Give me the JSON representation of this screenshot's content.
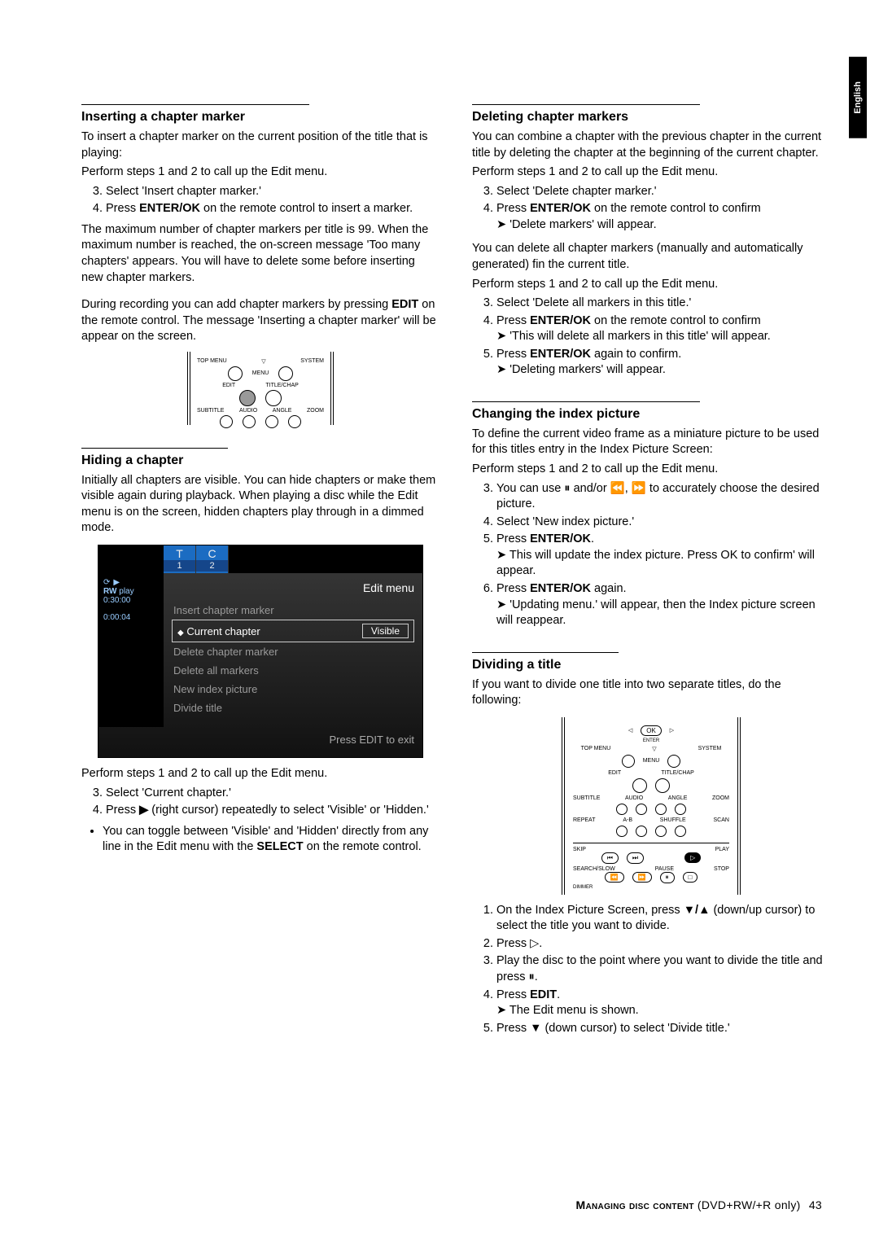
{
  "lang_tab": "English",
  "left": {
    "s1": {
      "h": "Inserting a chapter marker",
      "p1": "To insert a chapter marker on the current position of the title that is playing:",
      "p2": "Perform steps 1 and 2 to call up the Edit menu.",
      "li3": "Select 'Insert chapter marker.'",
      "li4a": "Press ",
      "li4b": "ENTER/OK",
      "li4c": " on the remote control to insert a marker.",
      "p3": "The maximum number of chapter markers per title is 99. When the maximum number is reached, the on-screen message 'Too many chapters' appears. You will have to delete some before inserting new chapter markers.",
      "p4a": "During recording you can add chapter markers by pressing ",
      "p4b": "EDIT",
      "p4c": " on the remote control. The message 'Inserting a chapter marker' will be appear on the screen.",
      "remote_labels": {
        "topmenu": "TOP MENU",
        "system": "SYSTEM",
        "menu": "MENU",
        "edit": "EDIT",
        "titlechap": "TITLE/CHAP",
        "subtitle": "SUBTITLE",
        "audio": "AUDIO",
        "angle": "ANGLE",
        "zoom": "ZOOM"
      }
    },
    "s2": {
      "h": "Hiding a chapter",
      "p1": "Initially all chapters are visible. You can hide chapters or make them visible again during playback. When playing a disc while the Edit menu is on the screen, hidden chapters play through in a dimmed mode.",
      "menu": {
        "t": "T",
        "c": "C",
        "n1": "1",
        "n2": "2",
        "rw": "RW",
        "play": "play",
        "time1": "0:30:00",
        "time2": "0:00:04",
        "title": "Edit menu",
        "insert": "Insert chapter marker",
        "current": "Current chapter",
        "visible": "Visible",
        "delete": "Delete chapter marker",
        "deleteall": "Delete all markers",
        "newindex": "New index picture",
        "divide": "Divide title",
        "foot": "Press EDIT to exit"
      },
      "p2": "Perform steps 1 and 2 to call up the Edit menu.",
      "li3": "Select 'Current chapter.'",
      "li4a": "Press ",
      "li4b": "▶",
      "li4c": " (right cursor) repeatedly to select 'Visible' or 'Hidden.'",
      "bul_a": "You can toggle between 'Visible' and 'Hidden' directly from any line in the Edit menu with the ",
      "bul_b": "SELECT",
      "bul_c": " on the remote control."
    }
  },
  "right": {
    "s1": {
      "h": "Deleting chapter markers",
      "p1": "You can combine a chapter with the previous chapter in the current title by deleting the chapter at the beginning of the current chapter.",
      "p2": "Perform steps 1 and 2 to call up the Edit menu.",
      "li3": "Select 'Delete chapter marker.'",
      "li4a": "Press ",
      "li4b": "ENTER/OK",
      "li4c": " on the remote control to confirm",
      "li4r": "'Delete markers' will appear.",
      "p3": "You can delete all chapter markers (manually and automatically generated) fin the current title.",
      "p4": "Perform steps 1 and 2 to call up the Edit menu.",
      "li3b": "Select 'Delete all markers in this title.'",
      "li4ba": "Press ",
      "li4bb": "ENTER/OK",
      "li4bc": " on the remote control to confirm",
      "li4br": "'This will delete all markers in this title' will appear.",
      "li5a": "Press ",
      "li5b": "ENTER/OK",
      "li5c": " again to confirm.",
      "li5r": "'Deleting markers' will appear."
    },
    "s2": {
      "h": "Changing the index picture",
      "p1": "To define the current video frame as a miniature picture to be used for this titles entry in the Index Picture Screen:",
      "p2": "Perform steps 1 and 2 to call up the Edit menu.",
      "li3": "You can use ⏸ and/or ⏪, ⏩ to accurately choose the desired picture.",
      "li4": "Select 'New index picture.'",
      "li5a": "Press ",
      "li5b": "ENTER/OK",
      "li5c": ".",
      "li5r": "This will update the index picture. Press OK to confirm' will appear.",
      "li6a": "Press ",
      "li6b": "ENTER/OK",
      "li6c": " again.",
      "li6r": "'Updating menu.' will appear, then the Index picture screen will reappear."
    },
    "s3": {
      "h": "Dividing a title",
      "p1": "If you want to divide one title into two separate titles, do the following:",
      "remote": {
        "ok": "OK",
        "enter": "ENTER",
        "topmenu": "TOP MENU",
        "system": "SYSTEM",
        "menu": "MENU",
        "edit": "EDIT",
        "titlechap": "TITLE/CHAP",
        "subtitle": "SUBTITLE",
        "audio": "AUDIO",
        "angle": "ANGLE",
        "zoom": "ZOOM",
        "repeat": "REPEAT",
        "ab": "A-B",
        "shuffle": "SHUFFLE",
        "scan": "SCAN",
        "skip": "SKIP",
        "play": "PLAY",
        "search": "SEARCH/SLOW",
        "pause": "PAUSE",
        "stop": "STOP",
        "dimmer": "DIMMER"
      },
      "li1a": "On the Index Picture Screen, press ",
      "li1b": "▼/▲",
      "li1c": " (down/up cursor) to select the title you want to divide.",
      "li2": "Press ▷.",
      "li3": "Play the disc to the point where you want to divide the title and press ⏸.",
      "li4a": "Press ",
      "li4b": "EDIT",
      "li4c": ".",
      "li4r": "The Edit menu is shown.",
      "li5a": "Press ",
      "li5b": "▼",
      "li5c": " (down cursor) to select 'Divide title.'"
    }
  },
  "footer": {
    "title_a": "Managing disc content",
    "title_b": " (DVD+RW/+R only)",
    "page": "43"
  }
}
